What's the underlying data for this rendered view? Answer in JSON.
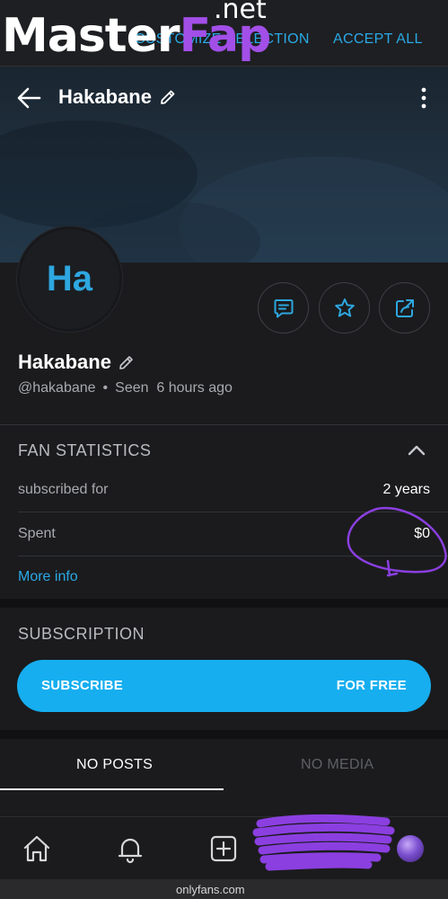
{
  "watermark": {
    "main": "Master",
    "accent": "Fap",
    "suffix": ".net"
  },
  "cookie_bar": {
    "customize_label": "CUSTOMIZE SELECTION",
    "accept_label": "ACCEPT ALL"
  },
  "header": {
    "title": "Hakabane"
  },
  "profile": {
    "avatar_initials": "Ha",
    "name": "Hakabane",
    "handle": "@hakabane",
    "separator": "•",
    "seen_label": "Seen",
    "seen_time": "6 hours ago"
  },
  "fan_statistics": {
    "title": "FAN STATISTICS",
    "rows": [
      {
        "label": "subscribed for",
        "value": "2 years"
      },
      {
        "label": "Spent",
        "value": "$0"
      }
    ],
    "more_info": "More info"
  },
  "subscription": {
    "title": "SUBSCRIPTION",
    "button_left": "SUBSCRIBE",
    "button_right": "FOR FREE"
  },
  "tabs": [
    {
      "label": "NO POSTS",
      "active": true
    },
    {
      "label": "NO MEDIA",
      "active": false
    }
  ],
  "browser": {
    "url": "onlyfans.com"
  },
  "colors": {
    "accent": "#16aeef",
    "link": "#29a9e6",
    "background": "#1b1b1d",
    "annotation": "#8b3fe0"
  },
  "icons": {
    "header": [
      "back-arrow-icon",
      "pencil-icon",
      "more-vertical-icon"
    ],
    "actions": [
      "message-icon",
      "star-icon",
      "share-icon"
    ],
    "nav": [
      "home-icon",
      "bell-icon",
      "add-square-icon"
    ]
  }
}
